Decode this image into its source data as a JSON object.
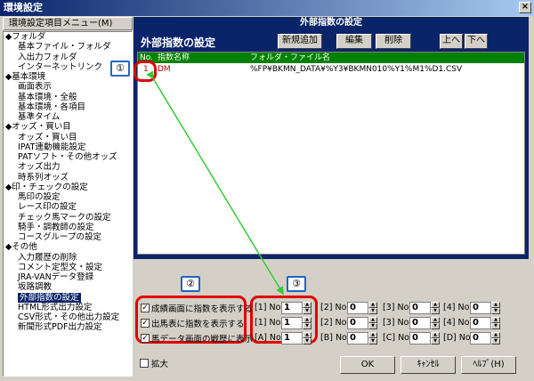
{
  "window": {
    "title": "環境設定"
  },
  "sidebar": {
    "header": "環境設定項目メニュー(M)",
    "items": [
      {
        "label": "◆フォルダ",
        "cat": true
      },
      {
        "label": "基本ファイル・フォルダ"
      },
      {
        "label": "入出力フォルダ"
      },
      {
        "label": "インターネットリンク"
      },
      {
        "label": "◆基本環境",
        "cat": true
      },
      {
        "label": "画面表示"
      },
      {
        "label": "基本環境・全般"
      },
      {
        "label": "基本環境・各項目"
      },
      {
        "label": "基準タイム"
      },
      {
        "label": "◆オッズ・買い目",
        "cat": true
      },
      {
        "label": "オッズ・買い目"
      },
      {
        "label": "IPAT連動機能設定"
      },
      {
        "label": "PATソフト・その他オッズ"
      },
      {
        "label": "オッズ出力"
      },
      {
        "label": "時系列オッズ"
      },
      {
        "label": "◆印・チェックの設定",
        "cat": true
      },
      {
        "label": "馬印の設定"
      },
      {
        "label": "レース印の設定"
      },
      {
        "label": "チェック馬マークの設定"
      },
      {
        "label": "騎手・調教師の設定"
      },
      {
        "label": "コースグループの設定"
      },
      {
        "label": "◆その他",
        "cat": true
      },
      {
        "label": "入力履歴の削除"
      },
      {
        "label": "コメント定型文・設定"
      },
      {
        "label": "JRA-VANデータ登録"
      },
      {
        "label": "坂路調教"
      },
      {
        "label": "外部指数の設定",
        "selected": true
      },
      {
        "label": "HTML形式出力設定"
      },
      {
        "label": "CSV形式・その他出力設定"
      },
      {
        "label": "新聞形式PDF出力設定"
      }
    ]
  },
  "panel": {
    "title": "外部指数の設定",
    "heading": "外部指数の設定",
    "buttons": {
      "add": "新規追加",
      "edit": "編集",
      "delete": "削除",
      "up": "上へ",
      "down": "下へ"
    },
    "table": {
      "headers": [
        "No.",
        "指数名称",
        "フォルダ・ファイル名"
      ],
      "rows": [
        [
          "1",
          "DM",
          "%FP¥BKMN_DATA¥%Y3¥BKMN010%Y1%M1%D1.CSV"
        ]
      ]
    }
  },
  "options": {
    "checks": [
      {
        "label": "成績画面に指数を表示する",
        "checked": "✓"
      },
      {
        "label": "出馬表に指数を表示する",
        "checked": "✓"
      },
      {
        "label": "馬データ画面の戦歴に表示",
        "checked": "✓"
      }
    ],
    "rows": [
      [
        {
          "label": "[1] No.",
          "value": "1"
        },
        {
          "label": "[2] No.",
          "value": "0"
        },
        {
          "label": "[3] No.",
          "value": "0"
        },
        {
          "label": "[4] No.",
          "value": "0"
        }
      ],
      [
        {
          "label": "[1] No.",
          "value": "1"
        },
        {
          "label": "[2] No.",
          "value": "0"
        },
        {
          "label": "[3] No.",
          "value": "0"
        },
        {
          "label": "[4] No.",
          "value": "0"
        }
      ],
      [
        {
          "label": "[A] No.",
          "value": "1"
        },
        {
          "label": "[B] No.",
          "value": "0"
        },
        {
          "label": "[C] No.",
          "value": "0"
        },
        {
          "label": "[D] No.",
          "value": "0"
        }
      ]
    ]
  },
  "footer": {
    "zoom_label": "拡大",
    "ok": "OK",
    "cancel": "ｷｬﾝｾﾙ",
    "help": "ﾍﾙﾌﾟ(H)"
  },
  "callouts": {
    "one": "①",
    "two": "②",
    "three": "③"
  },
  "colors": {
    "highlight": "#e00000",
    "callout_border": "#1f66c2",
    "arrow": "#33cc33"
  }
}
